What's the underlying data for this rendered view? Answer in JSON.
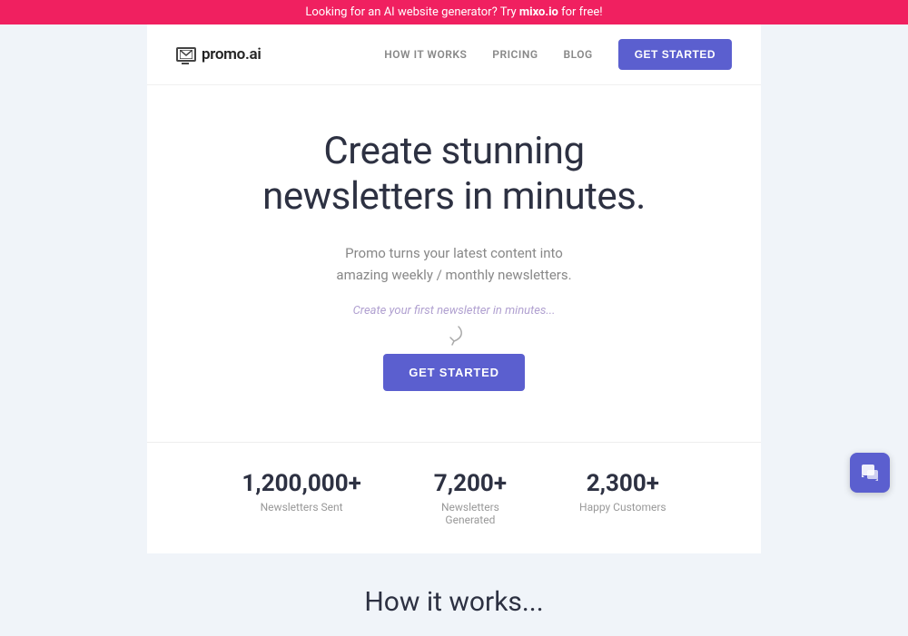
{
  "banner": {
    "text_before": "Looking for an AI website generator? Try ",
    "link_text": "mixo.io",
    "text_after": " for free!"
  },
  "navbar": {
    "logo_icon_alt": "email-envelope",
    "logo_text": "promo.ai",
    "links": [
      {
        "id": "how-it-works",
        "label": "HOW IT WORKS"
      },
      {
        "id": "pricing",
        "label": "PRICING"
      },
      {
        "id": "blog",
        "label": "BLOG"
      }
    ],
    "cta_label": "GET STARTED"
  },
  "hero": {
    "title_line1": "Create stunning",
    "title_line2": "newsletters in minutes.",
    "subtitle": "Promo turns your latest content into amazing weekly / monthly newsletters.",
    "input_placeholder": "Create your first newsletter in minutes...",
    "cta_label": "GET STARTED"
  },
  "stats": [
    {
      "id": "newsletters-sent",
      "number": "1,200,000+",
      "label": "Newsletters Sent"
    },
    {
      "id": "newsletters-generated",
      "number": "7,200+",
      "label_line1": "Newsletters",
      "label_line2": "Generated"
    },
    {
      "id": "happy-customers",
      "number": "2,300+",
      "label": "Happy Customers"
    }
  ],
  "how_section": {
    "title": "How it works..."
  },
  "colors": {
    "accent": "#5b5fcf",
    "banner_bg": "#f02060",
    "text_dark": "#2d3142",
    "text_muted": "#888888",
    "text_input": "#b0a0d0"
  }
}
